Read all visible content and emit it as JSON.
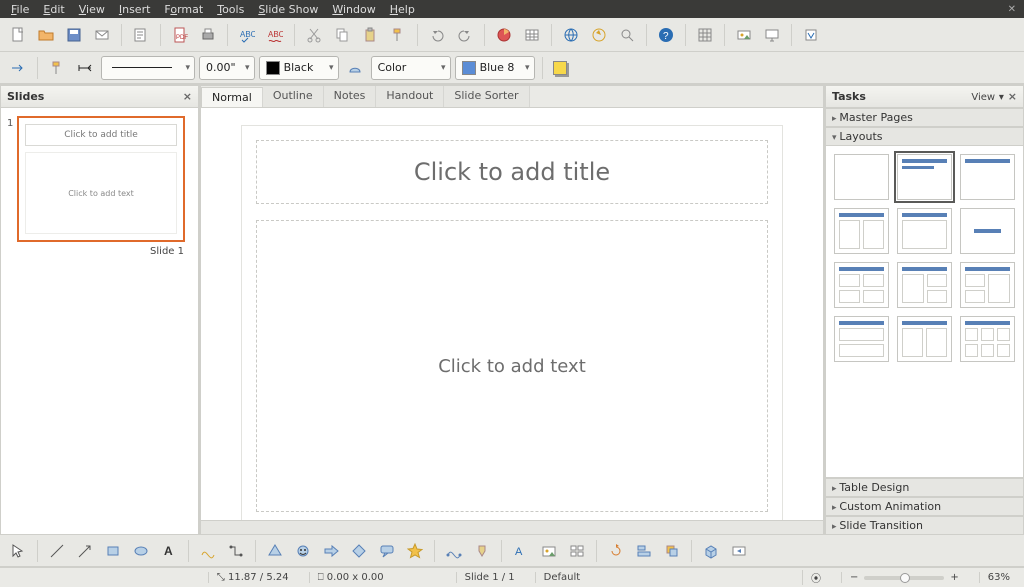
{
  "menu": {
    "items": [
      "File",
      "Edit",
      "View",
      "Insert",
      "Format",
      "Tools",
      "Slide Show",
      "Window",
      "Help"
    ]
  },
  "toolbar1": {
    "line_width": "0.00\"",
    "line_color_label": "Black",
    "fill_label": "Color",
    "fill_color_label": "Blue 8"
  },
  "slides_panel": {
    "title": "Slides",
    "thumb_title": "Click to add title",
    "thumb_body": "Click to add text",
    "thumb_num": "1",
    "thumb_label": "Slide 1"
  },
  "view_tabs": [
    "Normal",
    "Outline",
    "Notes",
    "Handout",
    "Slide Sorter"
  ],
  "canvas": {
    "title_placeholder": "Click to add title",
    "body_placeholder": "Click to add text"
  },
  "tasks": {
    "title": "Tasks",
    "view_label": "View",
    "sections": [
      "Master Pages",
      "Layouts",
      "Table Design",
      "Custom Animation",
      "Slide Transition"
    ]
  },
  "status": {
    "pos": "11.87 / 5.24",
    "size": "0.00 x 0.00",
    "slide": "Slide 1 / 1",
    "template": "Default",
    "zoom": "63%"
  }
}
